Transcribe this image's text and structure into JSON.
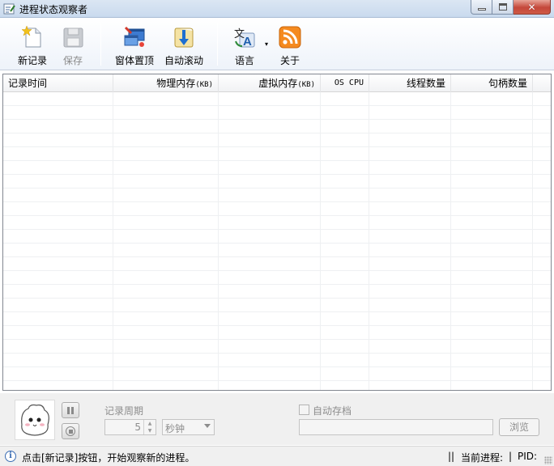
{
  "window": {
    "title": "进程状态观察者",
    "icon": "app-icon",
    "min_icon": "minimize-icon",
    "max_icon": "maximize-icon",
    "close_icon": "close-icon"
  },
  "toolbar": {
    "new_record": "新记录",
    "save": "保存",
    "topmost": "窗体置顶",
    "autoscroll": "自动滚动",
    "language": "语言",
    "about": "关于",
    "dropdown_arrow": "▾"
  },
  "list": {
    "columns": [
      {
        "label": "记录时间"
      },
      {
        "label": "物理内存",
        "unit": "(KB)"
      },
      {
        "label": "虚拟内存",
        "unit": "(KB)"
      },
      {
        "label": "OS CPU"
      },
      {
        "label": "线程数量"
      },
      {
        "label": "句柄数量"
      }
    ]
  },
  "controls": {
    "period_label": "记录周期",
    "period_value": "5",
    "period_unit": "秒钟",
    "autosave_label": "自动存档",
    "path_value": "",
    "browse": "浏览"
  },
  "status": {
    "message": "点击[新记录]按钮，开始观察新的进程。",
    "sep": "||",
    "current_process": "当前进程:",
    "bar": "|",
    "pid": "PID:"
  }
}
